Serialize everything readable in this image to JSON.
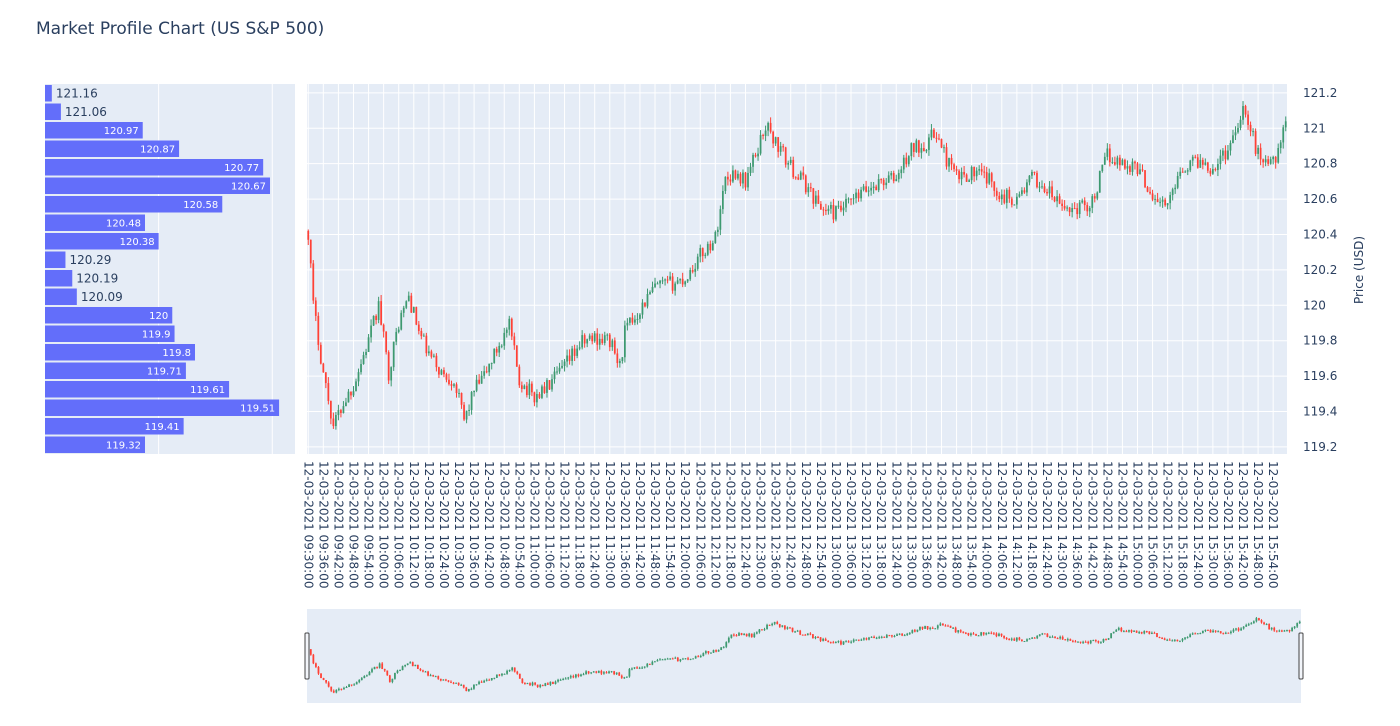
{
  "chart_title": "Market Profile Chart (US S&P 500)",
  "chart_data": [
    {
      "type": "bar",
      "orientation": "horizontal",
      "name": "volume-profile",
      "bar_color": "#636efa",
      "categories": [
        "121.16",
        "121.06",
        "120.97",
        "120.87",
        "120.77",
        "120.67",
        "120.58",
        "120.48",
        "120.38",
        "120.29",
        "120.19",
        "120.09",
        "120",
        "119.9",
        "119.8",
        "119.71",
        "119.61",
        "119.51",
        "119.41",
        "119.32"
      ],
      "values": [
        3,
        7,
        43,
        59,
        96,
        99,
        78,
        44,
        50,
        9,
        12,
        14,
        56,
        57,
        66,
        62,
        81,
        103,
        61,
        44
      ],
      "xlim": [
        0,
        110
      ]
    },
    {
      "type": "candlestick",
      "ylabel": "Price (USD)",
      "ylim": [
        119.16,
        121.25
      ],
      "yticks": [
        119.2,
        119.4,
        119.6,
        119.8,
        120,
        120.2,
        120.4,
        120.6,
        120.8,
        121,
        121.2
      ],
      "increasing_color": "#3d9970",
      "decreasing_color": "#ff4136",
      "x_start": "12-03-2021 09:30:00",
      "x_end": "12-03-2021 15:59:00",
      "interval_minutes": 1,
      "xticks": [
        "12-03-2021 09:30:00",
        "12-03-2021 09:36:00",
        "12-03-2021 09:42:00",
        "12-03-2021 09:48:00",
        "12-03-2021 09:54:00",
        "12-03-2021 10:00:00",
        "12-03-2021 10:06:00",
        "12-03-2021 10:12:00",
        "12-03-2021 10:18:00",
        "12-03-2021 10:24:00",
        "12-03-2021 10:30:00",
        "12-03-2021 10:36:00",
        "12-03-2021 10:42:00",
        "12-03-2021 10:48:00",
        "12-03-2021 10:54:00",
        "12-03-2021 11:00:00",
        "12-03-2021 11:06:00",
        "12-03-2021 11:12:00",
        "12-03-2021 11:18:00",
        "12-03-2021 11:24:00",
        "12-03-2021 11:30:00",
        "12-03-2021 11:36:00",
        "12-03-2021 11:42:00",
        "12-03-2021 11:48:00",
        "12-03-2021 11:54:00",
        "12-03-2021 12:00:00",
        "12-03-2021 12:06:00",
        "12-03-2021 12:12:00",
        "12-03-2021 12:18:00",
        "12-03-2021 12:24:00",
        "12-03-2021 12:30:00",
        "12-03-2021 12:36:00",
        "12-03-2021 12:42:00",
        "12-03-2021 12:48:00",
        "12-03-2021 12:54:00",
        "12-03-2021 13:00:00",
        "12-03-2021 13:06:00",
        "12-03-2021 13:12:00",
        "12-03-2021 13:18:00",
        "12-03-2021 13:24:00",
        "12-03-2021 13:30:00",
        "12-03-2021 13:36:00",
        "12-03-2021 13:42:00",
        "12-03-2021 13:48:00",
        "12-03-2021 13:54:00",
        "12-03-2021 14:00:00",
        "12-03-2021 14:06:00",
        "12-03-2021 14:12:00",
        "12-03-2021 14:18:00",
        "12-03-2021 14:24:00",
        "12-03-2021 14:30:00",
        "12-03-2021 14:36:00",
        "12-03-2021 14:42:00",
        "12-03-2021 14:48:00",
        "12-03-2021 14:54:00",
        "12-03-2021 15:00:00",
        "12-03-2021 15:06:00",
        "12-03-2021 15:12:00",
        "12-03-2021 15:18:00",
        "12-03-2021 15:24:00",
        "12-03-2021 15:30:00",
        "12-03-2021 15:36:00",
        "12-03-2021 15:42:00",
        "12-03-2021 15:48:00",
        "12-03-2021 15:54:00"
      ],
      "close_keypoints": [
        [
          "12-03-2021 09:30:00",
          120.42
        ],
        [
          "12-03-2021 09:32:00",
          120.0
        ],
        [
          "12-03-2021 09:36:00",
          119.62
        ],
        [
          "12-03-2021 09:40:00",
          119.32
        ],
        [
          "12-03-2021 09:44:00",
          119.45
        ],
        [
          "12-03-2021 09:48:00",
          119.55
        ],
        [
          "12-03-2021 09:54:00",
          119.8
        ],
        [
          "12-03-2021 09:58:00",
          120.0
        ],
        [
          "12-03-2021 10:02:00",
          119.62
        ],
        [
          "12-03-2021 10:06:00",
          119.9
        ],
        [
          "12-03-2021 10:10:00",
          120.05
        ],
        [
          "12-03-2021 10:14:00",
          119.85
        ],
        [
          "12-03-2021 10:18:00",
          119.72
        ],
        [
          "12-03-2021 10:24:00",
          119.6
        ],
        [
          "12-03-2021 10:28:00",
          119.58
        ],
        [
          "12-03-2021 10:32:00",
          119.35
        ],
        [
          "12-03-2021 10:36:00",
          119.52
        ],
        [
          "12-03-2021 10:40:00",
          119.6
        ],
        [
          "12-03-2021 10:46:00",
          119.78
        ],
        [
          "12-03-2021 10:50:00",
          119.88
        ],
        [
          "12-03-2021 10:54:00",
          119.58
        ],
        [
          "12-03-2021 11:00:00",
          119.48
        ],
        [
          "12-03-2021 11:06:00",
          119.55
        ],
        [
          "12-03-2021 11:12:00",
          119.65
        ],
        [
          "12-03-2021 11:18:00",
          119.78
        ],
        [
          "12-03-2021 11:24:00",
          119.82
        ],
        [
          "12-03-2021 11:30:00",
          119.8
        ],
        [
          "12-03-2021 11:34:00",
          119.65
        ],
        [
          "12-03-2021 11:36:00",
          119.85
        ],
        [
          "12-03-2021 11:42:00",
          119.98
        ],
        [
          "12-03-2021 11:48:00",
          120.1
        ],
        [
          "12-03-2021 11:54:00",
          120.12
        ],
        [
          "12-03-2021 12:00:00",
          120.15
        ],
        [
          "12-03-2021 12:06:00",
          120.28
        ],
        [
          "12-03-2021 12:12:00",
          120.38
        ],
        [
          "12-03-2021 12:16:00",
          120.72
        ],
        [
          "12-03-2021 12:20:00",
          120.75
        ],
        [
          "12-03-2021 12:24:00",
          120.7
        ],
        [
          "12-03-2021 12:28:00",
          120.85
        ],
        [
          "12-03-2021 12:32:00",
          121.02
        ],
        [
          "12-03-2021 12:36:00",
          120.92
        ],
        [
          "12-03-2021 12:42:00",
          120.78
        ],
        [
          "12-03-2021 12:48:00",
          120.68
        ],
        [
          "12-03-2021 12:54:00",
          120.55
        ],
        [
          "12-03-2021 13:00:00",
          120.52
        ],
        [
          "12-03-2021 13:06:00",
          120.58
        ],
        [
          "12-03-2021 13:12:00",
          120.65
        ],
        [
          "12-03-2021 13:18:00",
          120.7
        ],
        [
          "12-03-2021 13:24:00",
          120.72
        ],
        [
          "12-03-2021 13:30:00",
          120.88
        ],
        [
          "12-03-2021 13:36:00",
          120.92
        ],
        [
          "12-03-2021 13:40:00",
          120.98
        ],
        [
          "12-03-2021 13:42:00",
          120.88
        ],
        [
          "12-03-2021 13:48:00",
          120.72
        ],
        [
          "12-03-2021 13:54:00",
          120.75
        ],
        [
          "12-03-2021 14:00:00",
          120.72
        ],
        [
          "12-03-2021 14:06:00",
          120.62
        ],
        [
          "12-03-2021 14:12:00",
          120.6
        ],
        [
          "12-03-2021 14:18:00",
          120.72
        ],
        [
          "12-03-2021 14:24:00",
          120.65
        ],
        [
          "12-03-2021 14:30:00",
          120.55
        ],
        [
          "12-03-2021 14:36:00",
          120.55
        ],
        [
          "12-03-2021 14:42:00",
          120.58
        ],
        [
          "12-03-2021 14:48:00",
          120.85
        ],
        [
          "12-03-2021 14:54:00",
          120.8
        ],
        [
          "12-03-2021 15:00:00",
          120.78
        ],
        [
          "12-03-2021 15:06:00",
          120.62
        ],
        [
          "12-03-2021 15:12:00",
          120.55
        ],
        [
          "12-03-2021 15:16:00",
          120.75
        ],
        [
          "12-03-2021 15:18:00",
          120.78
        ],
        [
          "12-03-2021 15:24:00",
          120.82
        ],
        [
          "12-03-2021 15:30:00",
          120.78
        ],
        [
          "12-03-2021 15:36:00",
          120.88
        ],
        [
          "12-03-2021 15:42:00",
          121.12
        ],
        [
          "12-03-2021 15:48:00",
          120.85
        ],
        [
          "12-03-2021 15:54:00",
          120.8
        ],
        [
          "12-03-2021 15:56:00",
          120.9
        ],
        [
          "12-03-2021 15:59:00",
          121.0
        ]
      ]
    }
  ]
}
